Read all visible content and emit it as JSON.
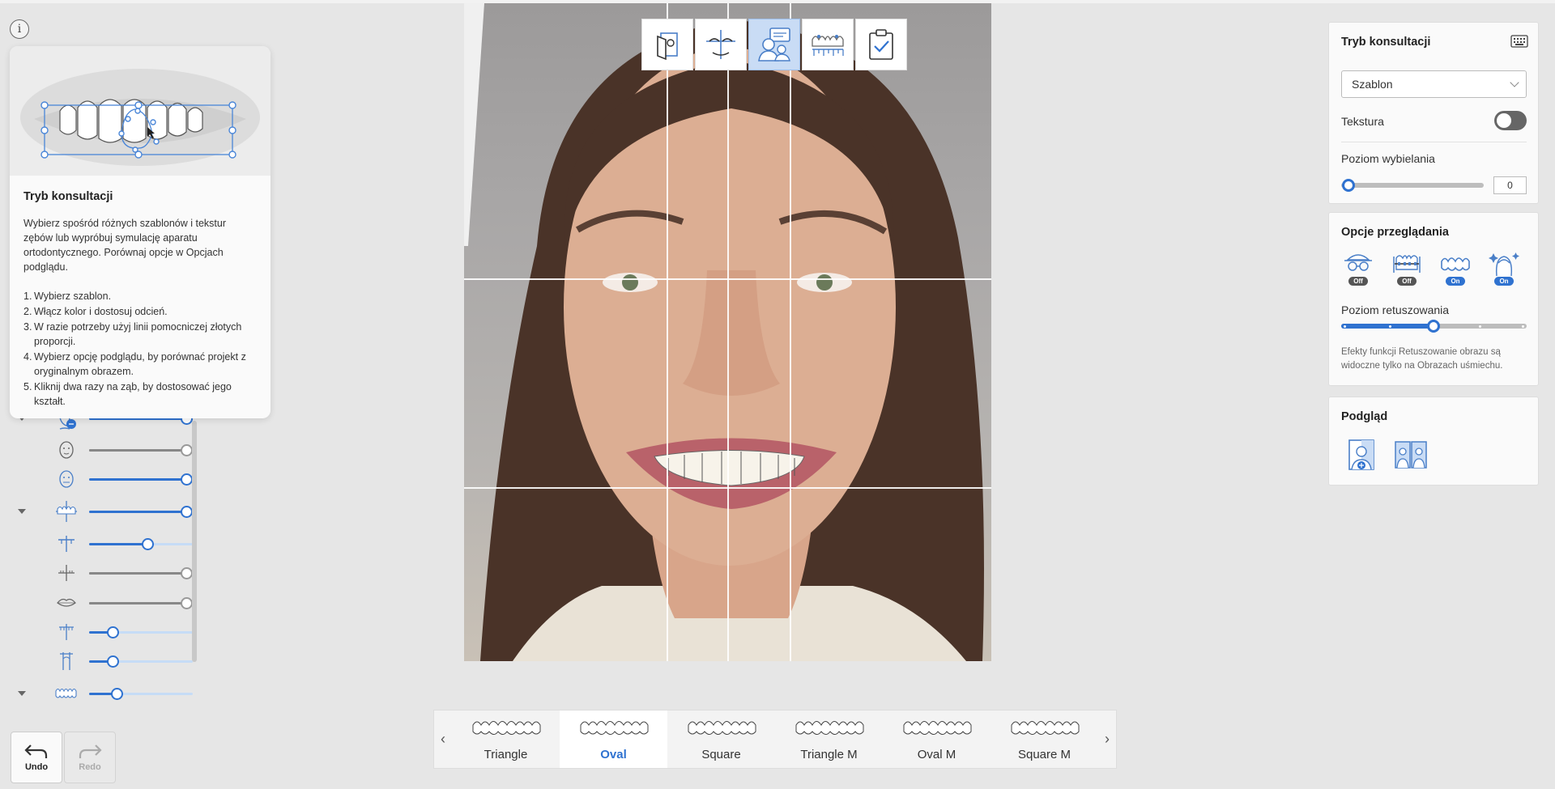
{
  "info_button": "i",
  "help": {
    "title": "Tryb konsultacji",
    "description": "Wybierz spośród różnych szablonów i tekstur zębów lub wypróbuj symulację aparatu ortodontycznego. Porównaj opcje w Opcjach podglądu.",
    "steps": [
      {
        "num": "1.",
        "text": "Wybierz szablon."
      },
      {
        "num": "2.",
        "text": "Włącz kolor i dostosuj odcień."
      },
      {
        "num": "3.",
        "text": "W razie potrzeby użyj linii pomocniczej złotych proporcji."
      },
      {
        "num": "4.",
        "text": "Wybierz opcję podglądu, by porównać projekt z oryginalnym obrazem."
      },
      {
        "num": "5.",
        "text": "Kliknij dwa razy na ząb, by dostosować jego kształt."
      }
    ]
  },
  "sliders": [
    {
      "icon": "face-adjust-icon",
      "expand": true,
      "value": 1.0,
      "style": "blue"
    },
    {
      "icon": "face-outline-icon",
      "expand": false,
      "value": 1.0,
      "style": "grey"
    },
    {
      "icon": "face-blue-icon",
      "expand": false,
      "value": 1.0,
      "style": "blue"
    },
    {
      "icon": "teeth-axis-icon",
      "expand": true,
      "value": 1.0,
      "style": "blue"
    },
    {
      "icon": "midline-icon",
      "expand": false,
      "value": 0.6,
      "style": "blue"
    },
    {
      "icon": "tooth-ruler-icon",
      "expand": false,
      "value": 1.0,
      "style": "grey"
    },
    {
      "icon": "lips-icon",
      "expand": false,
      "value": 1.0,
      "style": "grey"
    },
    {
      "icon": "tooth-width-icon",
      "expand": false,
      "value": 0.24,
      "style": "blue"
    },
    {
      "icon": "tooth-height-icon",
      "expand": false,
      "value": 0.24,
      "style": "blue"
    },
    {
      "icon": "teeth-row-icon",
      "expand": true,
      "value": 0.28,
      "style": "blue"
    }
  ],
  "undo": {
    "label": "Undo"
  },
  "redo": {
    "label": "Redo"
  },
  "tools": [
    {
      "name": "tool-photo-import",
      "icon": "photo-import-icon",
      "active": false
    },
    {
      "name": "tool-face-lines",
      "icon": "face-lines-icon",
      "active": false
    },
    {
      "name": "tool-consultation",
      "icon": "consultation-icon",
      "active": true
    },
    {
      "name": "tool-teeth-measure",
      "icon": "teeth-measure-icon",
      "active": false
    },
    {
      "name": "tool-checklist",
      "icon": "checklist-icon",
      "active": false
    }
  ],
  "templates": {
    "items": [
      {
        "label": "Triangle",
        "active": false
      },
      {
        "label": "Oval",
        "active": true
      },
      {
        "label": "Square",
        "active": false
      },
      {
        "label": "Triangle M",
        "active": false
      },
      {
        "label": "Oval M",
        "active": false
      },
      {
        "label": "Square M",
        "active": false
      }
    ],
    "prev_arrow": "‹",
    "next_arrow": "›"
  },
  "consultation": {
    "title": "Tryb konsultacji",
    "template_select": "Szablon",
    "texture_label": "Tekstura",
    "texture_on": false,
    "whitening_label": "Poziom wybielania",
    "whitening_value": "0"
  },
  "view_options": {
    "title": "Opcje przeglądania",
    "icons": [
      {
        "icon": "hide-face-icon",
        "state": "Off"
      },
      {
        "icon": "braces-icon",
        "state": "Off"
      },
      {
        "icon": "teeth-icon",
        "state": "On"
      },
      {
        "icon": "retouch-icon",
        "state": "On"
      }
    ],
    "retouch_label": "Poziom retuszowania",
    "retouch_level": 0.5,
    "note": "Efekty funkcji Retuszowanie obrazu są widoczne tylko na Obrazach uśmiechu."
  },
  "preview": {
    "title": "Podgląd",
    "icons": [
      "split-view-icon",
      "side-by-side-icon"
    ]
  },
  "colors": {
    "accent": "#2f72d0",
    "panel": "#fafafa",
    "background": "#e6e6e6"
  }
}
